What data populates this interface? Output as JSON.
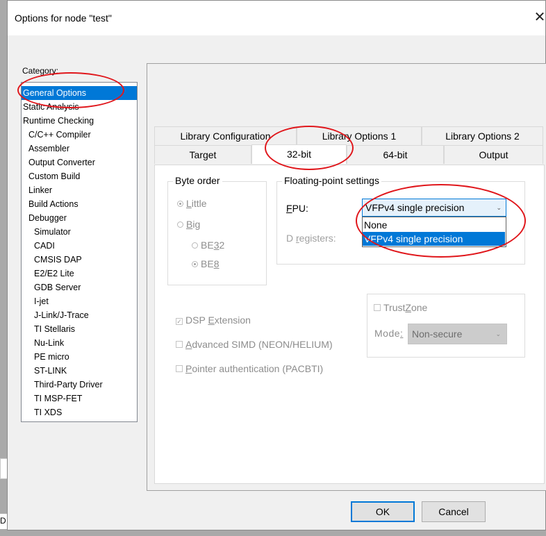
{
  "window": {
    "title": "Options for node \"test\"",
    "close_glyph": "✕"
  },
  "background": {
    "stub_text": "D"
  },
  "category": {
    "label": "Category:",
    "items": [
      {
        "label": "General Options",
        "selected": true,
        "indent": 0
      },
      {
        "label": "Static Analysis",
        "indent": 0
      },
      {
        "label": "Runtime Checking",
        "indent": 0
      },
      {
        "label": "C/C++ Compiler",
        "indent": 1
      },
      {
        "label": "Assembler",
        "indent": 1
      },
      {
        "label": "Output Converter",
        "indent": 1
      },
      {
        "label": "Custom Build",
        "indent": 1
      },
      {
        "label": "Linker",
        "indent": 1
      },
      {
        "label": "Build Actions",
        "indent": 1
      },
      {
        "label": "Debugger",
        "indent": 1
      },
      {
        "label": "Simulator",
        "indent": 2
      },
      {
        "label": "CADI",
        "indent": 2
      },
      {
        "label": "CMSIS DAP",
        "indent": 2
      },
      {
        "label": "E2/E2 Lite",
        "indent": 2
      },
      {
        "label": "GDB Server",
        "indent": 2
      },
      {
        "label": "I-jet",
        "indent": 2
      },
      {
        "label": "J-Link/J-Trace",
        "indent": 2
      },
      {
        "label": "TI Stellaris",
        "indent": 2
      },
      {
        "label": "Nu-Link",
        "indent": 2
      },
      {
        "label": "PE micro",
        "indent": 2
      },
      {
        "label": "ST-LINK",
        "indent": 2
      },
      {
        "label": "Third-Party Driver",
        "indent": 2
      },
      {
        "label": "TI MSP-FET",
        "indent": 2
      },
      {
        "label": "TI XDS",
        "indent": 2
      }
    ]
  },
  "tabs": {
    "row_back": [
      "Library Configuration",
      "Library Options 1",
      "Library Options 2"
    ],
    "row_front": [
      "Target",
      "32-bit",
      "64-bit",
      "Output"
    ],
    "active": "32-bit"
  },
  "byte_order": {
    "title": "Byte order",
    "little": {
      "pre": "",
      "ul": "L",
      "post": "ittle",
      "checked": true
    },
    "big": {
      "pre": "",
      "ul": "B",
      "post": "ig",
      "checked": false
    },
    "be32": {
      "pre": "BE",
      "ul": "3",
      "post": "2",
      "checked": false
    },
    "be8": {
      "pre": "BE",
      "ul": "8",
      "post": "",
      "checked": true
    }
  },
  "floating_point": {
    "title": "Floating-point settings",
    "fpu_label": {
      "ul": "F",
      "post": "PU:"
    },
    "fpu_value": "VFPv4 single precision",
    "d_registers_label": {
      "pre": "D ",
      "ul": "r",
      "post": "egisters:"
    },
    "dropdown_options": [
      "None",
      "VFPv4 single precision"
    ],
    "dropdown_selected": "VFPv4 single precision"
  },
  "extensions": {
    "dsp": {
      "pre": "DSP ",
      "ul": "E",
      "post": "xtension",
      "checked": true
    },
    "simd": {
      "pre": "",
      "ul": "A",
      "post": "dvanced SIMD (NEON/HELIUM)",
      "checked": false
    },
    "pacbti": {
      "pre": "",
      "ul": "P",
      "post": "ointer authentication (PACBTI)",
      "checked": false
    }
  },
  "trustzone": {
    "label": {
      "pre": "Trust",
      "ul": "Z",
      "post": "one"
    },
    "checked": false,
    "mode_label": {
      "pre": "Mode",
      "ul": ":",
      "post": ""
    },
    "mode_value": "Non-secure"
  },
  "buttons": {
    "ok": "OK",
    "cancel": "Cancel"
  },
  "colors": {
    "selection": "#0078d7",
    "annotation_ring": "#e0161b"
  }
}
